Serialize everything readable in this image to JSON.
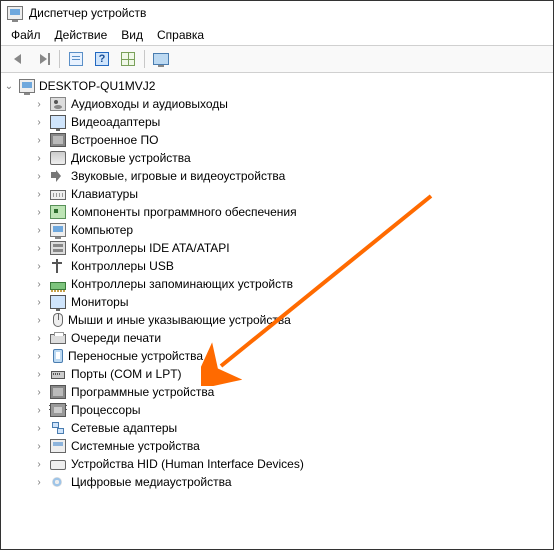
{
  "window": {
    "title": "Диспетчер устройств"
  },
  "menu": {
    "file": "Файл",
    "action": "Действие",
    "view": "Вид",
    "help": "Справка"
  },
  "tree": {
    "root": "DESKTOP-QU1MVJ2",
    "nodes": [
      {
        "label": "Аудиовходы и аудиовыходы",
        "icon": "i-speaker"
      },
      {
        "label": "Видеоадаптеры",
        "icon": "i-display"
      },
      {
        "label": "Встроенное ПО",
        "icon": "i-chip"
      },
      {
        "label": "Дисковые устройства",
        "icon": "i-disk"
      },
      {
        "label": "Звуковые, игровые и видеоустройства",
        "icon": "i-sound"
      },
      {
        "label": "Клавиатуры",
        "icon": "i-keyboard"
      },
      {
        "label": "Компоненты программного обеспечения",
        "icon": "i-component"
      },
      {
        "label": "Компьютер",
        "icon": "i-computer"
      },
      {
        "label": "Контроллеры IDE ATA/ATAPI",
        "icon": "i-ide"
      },
      {
        "label": "Контроллеры USB",
        "icon": "i-usb"
      },
      {
        "label": "Контроллеры запоминающих устройств",
        "icon": "i-memory"
      },
      {
        "label": "Мониторы",
        "icon": "i-display"
      },
      {
        "label": "Мыши и иные указывающие устройства",
        "icon": "i-mouse"
      },
      {
        "label": "Очереди печати",
        "icon": "i-printer"
      },
      {
        "label": "Переносные устройства",
        "icon": "i-portable"
      },
      {
        "label": "Порты (COM и LPT)",
        "icon": "i-port"
      },
      {
        "label": "Программные устройства",
        "icon": "i-chip"
      },
      {
        "label": "Процессоры",
        "icon": "i-cpu"
      },
      {
        "label": "Сетевые адаптеры",
        "icon": "i-network"
      },
      {
        "label": "Системные устройства",
        "icon": "i-system"
      },
      {
        "label": "Устройства HID (Human Interface Devices)",
        "icon": "i-hid"
      },
      {
        "label": "Цифровые медиаустройства",
        "icon": "i-media"
      }
    ]
  },
  "annotation": {
    "target_index": 14,
    "color": "#ff6a00"
  }
}
